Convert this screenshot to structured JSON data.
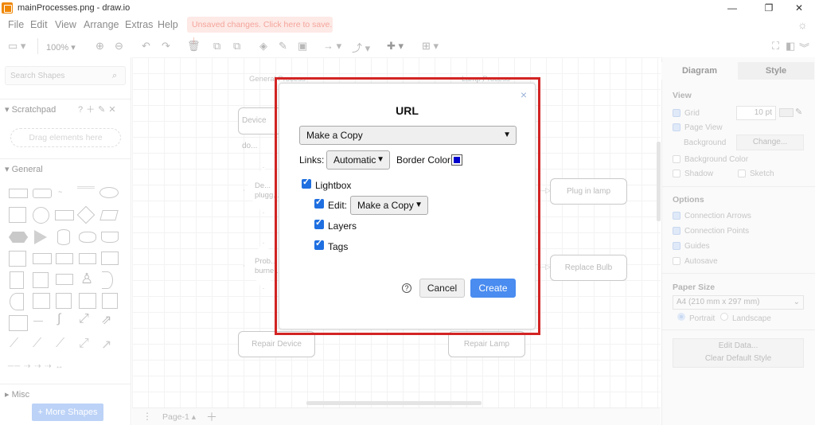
{
  "window": {
    "title": "mainProcesses.png - draw.io",
    "minimize": "—",
    "maximize": "❐",
    "close": "✕"
  },
  "menu": {
    "file": "File",
    "edit": "Edit",
    "view": "View",
    "arrange": "Arrange",
    "extras": "Extras",
    "help": "Help"
  },
  "unsaved_banner": "Unsaved changes. Click here to save.",
  "toolbar": {
    "zoom": "100%"
  },
  "left_panel": {
    "search_placeholder": "Search Shapes",
    "scratchpad": "Scratchpad",
    "drag_hint": "Drag elements here",
    "general": "General",
    "misc": "Misc",
    "more_shapes": "+ More Shapes"
  },
  "canvas": {
    "lane_left": "General Process",
    "lane_right": "Lamp Process",
    "nodes": {
      "device_doesnt": "Device do...",
      "device_plugged": "De... plugg...",
      "problem_burned": "Prob... burne...",
      "plug_in_lamp": "Plug in lamp",
      "replace_bulb": "Replace Bulb",
      "repair_device": "Repair Device",
      "repair_lamp": "Repair Lamp"
    },
    "page_tab": "Page-1"
  },
  "right_panel": {
    "tab_diagram": "Diagram",
    "tab_style": "Style",
    "view": "View",
    "grid": "Grid",
    "grid_size": "10 pt",
    "page_view": "Page View",
    "background": "Background",
    "change": "Change...",
    "background_color": "Background Color",
    "shadow": "Shadow",
    "sketch": "Sketch",
    "options": "Options",
    "connection_arrows": "Connection Arrows",
    "connection_points": "Connection Points",
    "guides": "Guides",
    "autosave": "Autosave",
    "paper_size": "Paper Size",
    "paper_value": "A4 (210 mm x 297 mm)",
    "portrait": "Portrait",
    "landscape": "Landscape",
    "edit_data": "Edit Data...",
    "clear_default_style": "Clear Default Style"
  },
  "dialog": {
    "title": "URL",
    "mode_select": "Make a Copy",
    "links_label": "Links:",
    "links_value": "Automatic",
    "border_color_label": "Border Color:",
    "border_color": "#0000cc",
    "lightbox": "Lightbox",
    "edit_label": "Edit:",
    "edit_value": "Make a Copy",
    "layers": "Layers",
    "tags": "Tags",
    "help": "?",
    "cancel": "Cancel",
    "create": "Create",
    "close": "×"
  }
}
